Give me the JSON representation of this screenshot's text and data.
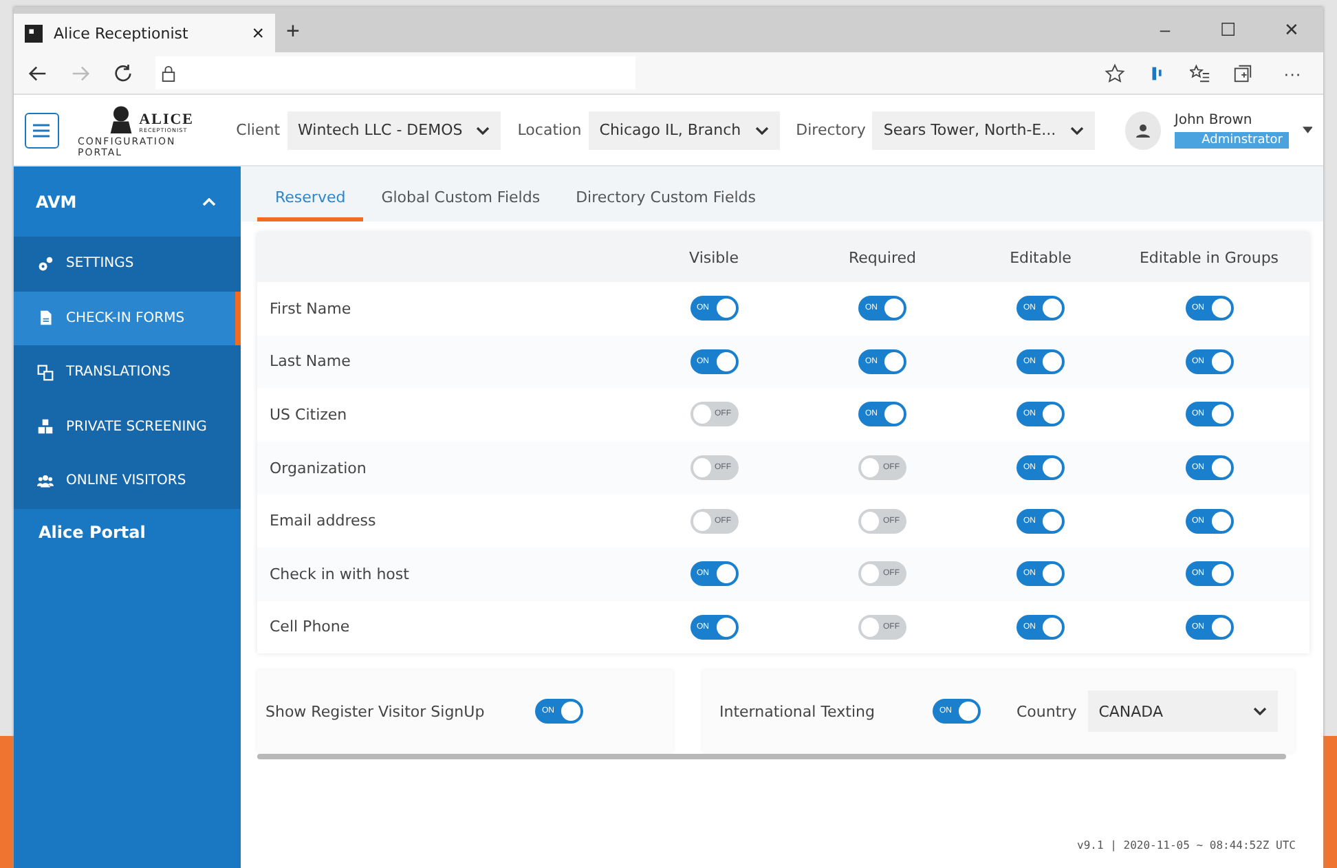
{
  "browser": {
    "tab_title": "Alice Receptionist",
    "tab_close": "×",
    "new_tab": "+",
    "window_controls": [
      "–",
      "☐",
      "✕"
    ],
    "more": "···"
  },
  "header": {
    "logo_word": "ALICE",
    "logo_sub": "RECEPTIONIST",
    "logo_caption": "CONFIGURATION PORTAL",
    "filters": [
      {
        "label": "Client",
        "value": "Wintech LLC - DEMOS"
      },
      {
        "label": "Location",
        "value": "Chicago IL, Branch"
      },
      {
        "label": "Directory",
        "value": "Sears Tower, North-E..."
      }
    ],
    "user": {
      "name": "John Brown",
      "role": "Adminstrator"
    }
  },
  "sidebar": {
    "section": {
      "title": "AVM",
      "expanded": true
    },
    "items": [
      {
        "label": "SETTINGS",
        "selected": false
      },
      {
        "label": "CHECK-IN FORMS",
        "selected": true
      },
      {
        "label": "TRANSLATIONS",
        "selected": false
      },
      {
        "label": "PRIVATE SCREENING",
        "selected": false
      },
      {
        "label": "ONLINE VISITORS",
        "selected": false
      }
    ],
    "footer": "Alice Portal"
  },
  "tabs": [
    {
      "label": "Reserved",
      "selected": true
    },
    {
      "label": "Global Custom Fields",
      "selected": false
    },
    {
      "label": "Directory Custom Fields",
      "selected": false
    }
  ],
  "table": {
    "columns": [
      "Visible",
      "Required",
      "Editable",
      "Editable in Groups"
    ],
    "rows": [
      {
        "name": "First Name",
        "toggles": [
          {
            "on": true,
            "text": "ON"
          },
          {
            "on": true,
            "text": "ON"
          },
          {
            "on": true,
            "text": "ON"
          },
          {
            "on": true,
            "text": "ON"
          }
        ]
      },
      {
        "name": "Last Name",
        "toggles": [
          {
            "on": true,
            "text": "ON"
          },
          {
            "on": true,
            "text": "ON"
          },
          {
            "on": true,
            "text": "ON"
          },
          {
            "on": true,
            "text": "ON"
          }
        ]
      },
      {
        "name": "US Citizen",
        "toggles": [
          {
            "on": false,
            "text": "OFF"
          },
          {
            "on": true,
            "text": "ON"
          },
          {
            "on": true,
            "text": "ON"
          },
          {
            "on": true,
            "text": "ON"
          }
        ]
      },
      {
        "name": "Organization",
        "toggles": [
          {
            "on": false,
            "text": "OFF"
          },
          {
            "on": false,
            "text": "OFF"
          },
          {
            "on": true,
            "text": "ON"
          },
          {
            "on": true,
            "text": "ON"
          }
        ]
      },
      {
        "name": "Email address",
        "toggles": [
          {
            "on": false,
            "text": "OFF"
          },
          {
            "on": false,
            "text": "OFF"
          },
          {
            "on": true,
            "text": "ON"
          },
          {
            "on": true,
            "text": "ON"
          }
        ]
      },
      {
        "name": "Check in with host",
        "toggles": [
          {
            "on": true,
            "text": "ON"
          },
          {
            "on": false,
            "text": "OFF"
          },
          {
            "on": true,
            "text": "ON"
          },
          {
            "on": true,
            "text": "ON"
          }
        ]
      },
      {
        "name": "Cell Phone",
        "toggles": [
          {
            "on": true,
            "text": "ON"
          },
          {
            "on": false,
            "text": "OFF"
          },
          {
            "on": true,
            "text": "ON"
          },
          {
            "on": true,
            "text": "ON"
          }
        ]
      }
    ]
  },
  "options": {
    "register": {
      "label": "Show Register Visitor SignUp",
      "toggle": {
        "on": true,
        "text": "ON"
      }
    },
    "texting": {
      "label": "International Texting",
      "toggle": {
        "on": true,
        "text": "ON"
      }
    },
    "country": {
      "label": "Country",
      "value": "CANADA"
    }
  },
  "version": "v9.1 | 2020-11-05 ~ 08:44:52Z UTC"
}
